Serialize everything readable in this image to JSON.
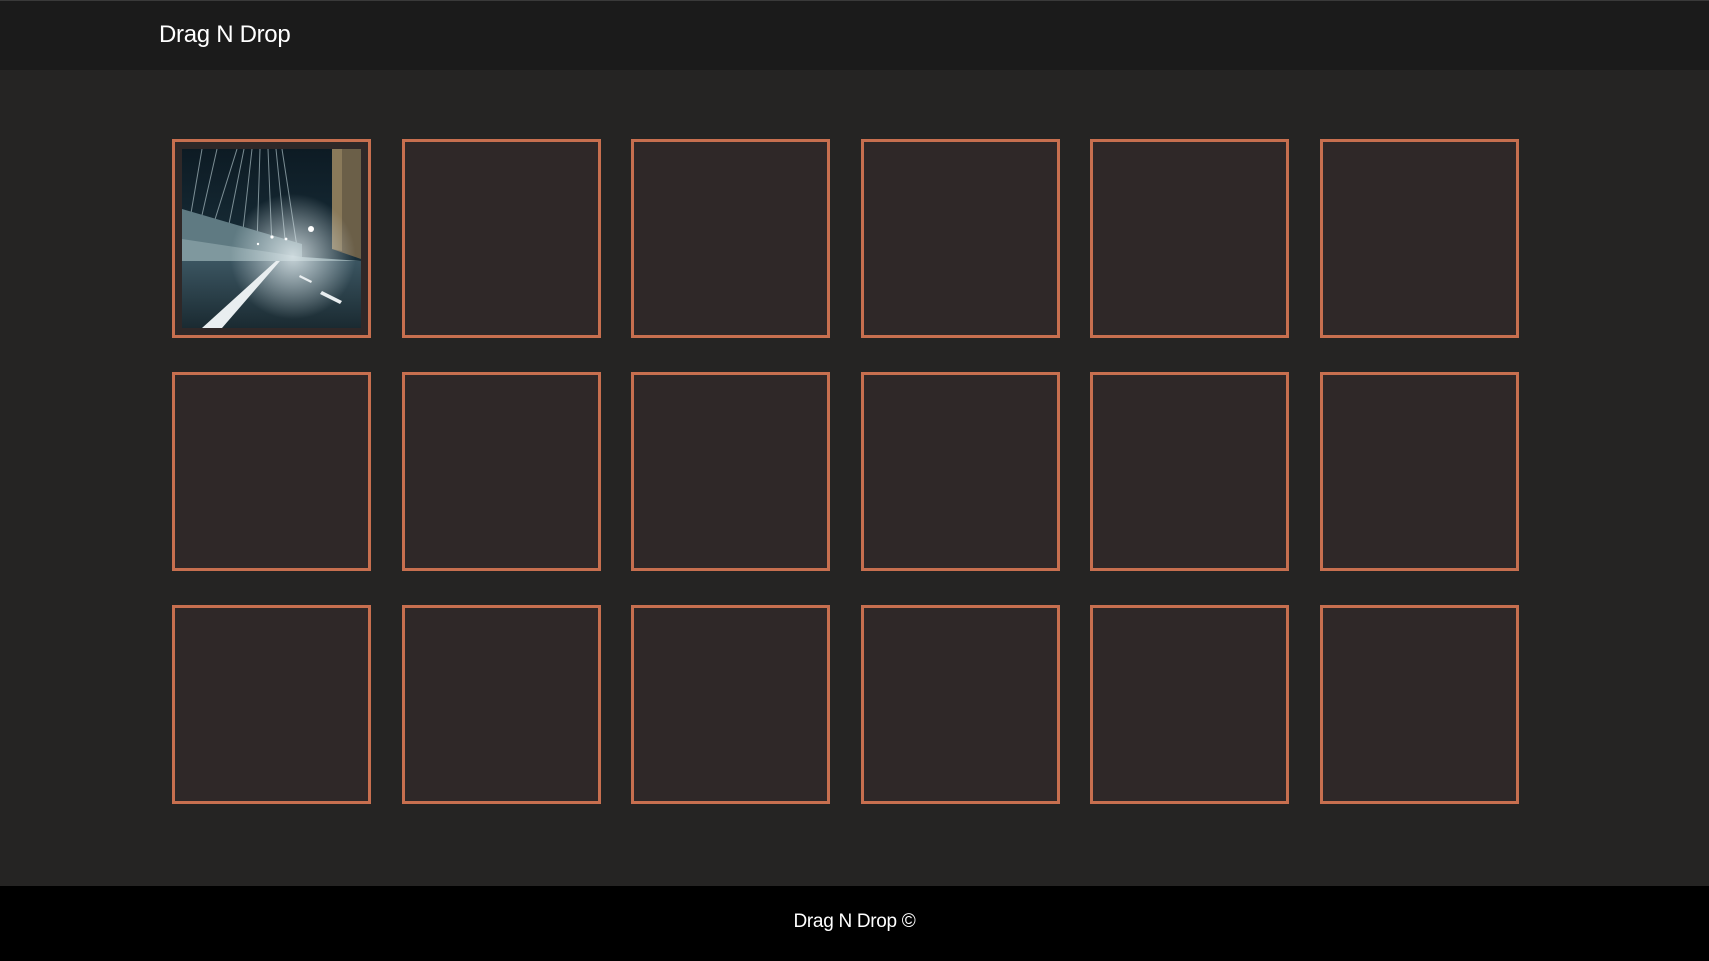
{
  "header": {
    "title": "Drag N Drop"
  },
  "board": {
    "rows": 3,
    "columns": 6,
    "cells": [
      {
        "has_item": true,
        "item_icon": "night-road-photo-icon"
      },
      {
        "has_item": false
      },
      {
        "has_item": false
      },
      {
        "has_item": false
      },
      {
        "has_item": false
      },
      {
        "has_item": false
      },
      {
        "has_item": false
      },
      {
        "has_item": false
      },
      {
        "has_item": false
      },
      {
        "has_item": false
      },
      {
        "has_item": false
      },
      {
        "has_item": false
      },
      {
        "has_item": false
      },
      {
        "has_item": false
      },
      {
        "has_item": false
      },
      {
        "has_item": false
      },
      {
        "has_item": false
      },
      {
        "has_item": false
      }
    ]
  },
  "footer": {
    "copyright": "Drag N Drop ©"
  },
  "colors": {
    "page_background": "#252423",
    "header_background": "#1b1b1b",
    "footer_background": "#000000",
    "cell_border": "#c76f4f",
    "cell_background": "#2f2828",
    "text": "#ffffff"
  }
}
